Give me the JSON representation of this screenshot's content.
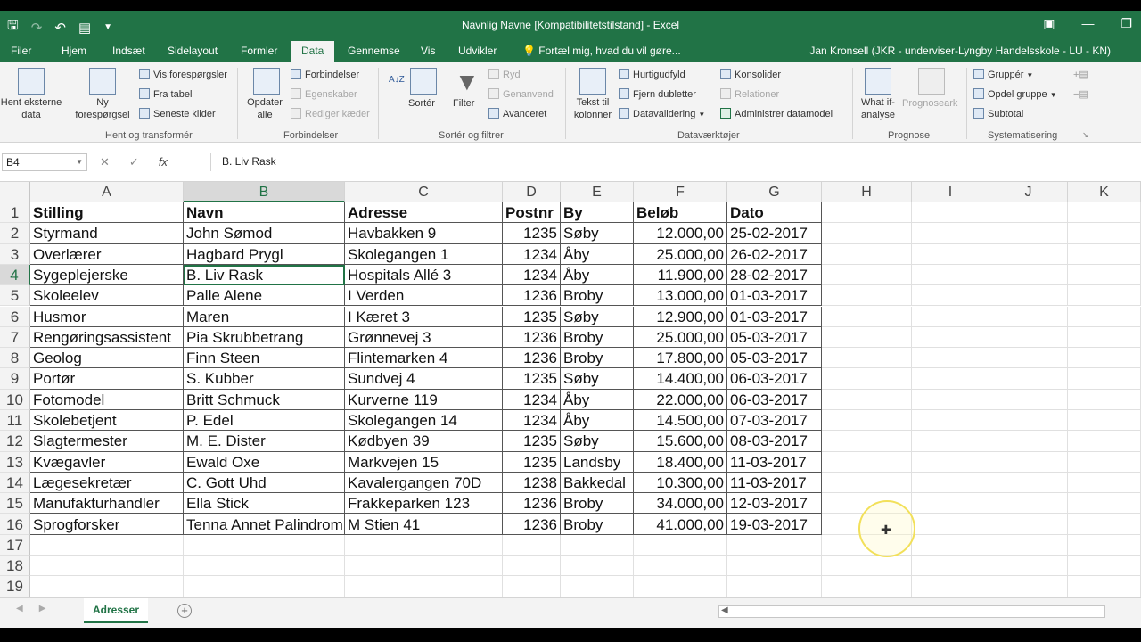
{
  "window": {
    "title": "Navnlig Navne  [Kompatibilitetstilstand] - Excel"
  },
  "ribbon_tabs": [
    {
      "label": "Filer"
    },
    {
      "label": "Hjem"
    },
    {
      "label": "Indsæt"
    },
    {
      "label": "Sidelayout"
    },
    {
      "label": "Formler"
    },
    {
      "label": "Data"
    },
    {
      "label": "Gennemse"
    },
    {
      "label": "Vis"
    },
    {
      "label": "Udvikler"
    }
  ],
  "tellme": "Fortæl mig, hvad du vil gøre...",
  "user": "Jan Kronsell (JKR - underviser-Lyngby Handelsskole - LU - KN)",
  "ribbon": {
    "hent_eksterne": [
      "Hent eksterne",
      "data"
    ],
    "ny": [
      "Ny",
      "forespørgsel"
    ],
    "vis_forespoergsler": "Vis forespørgsler",
    "fra_tabel": "Fra tabel",
    "seneste_kilder": "Seneste kilder",
    "group_hent": "Hent og transformér",
    "opdater": [
      "Opdater",
      "alle"
    ],
    "forbindelser": "Forbindelser",
    "egenskaber": "Egenskaber",
    "rediger_kaeder": "Rediger kæder",
    "group_forbindelser": "Forbindelser",
    "sorter": "Sortér",
    "filter": "Filter",
    "ryd": "Ryd",
    "genanvend": "Genanvend",
    "avanceret": "Avanceret",
    "group_sorter": "Sortér og filtrer",
    "tekst_til": [
      "Tekst til",
      "kolonner"
    ],
    "hurtigudfyld": "Hurtigudfyld",
    "fjern_dubletter": "Fjern dubletter",
    "datavalidering": "Datavalidering",
    "konsolider": "Konsolider",
    "relationer": "Relationer",
    "administrer": "Administrer datamodel",
    "group_datavaerktoejer": "Dataværktøjer",
    "what_if": [
      "What if-",
      "analyse"
    ],
    "prognoseark": "Prognoseark",
    "group_prognose": "Prognose",
    "grupper": "Gruppér",
    "opdel_gruppe": "Opdel gruppe",
    "subtotal": "Subtotal",
    "group_system": "Systematisering"
  },
  "formula_bar": {
    "name_box": "B4",
    "fx": "fx",
    "content": "B. Liv Rask"
  },
  "columns": [
    "A",
    "B",
    "C",
    "D",
    "E",
    "F",
    "G",
    "H",
    "I",
    "J",
    "K"
  ],
  "rows": [
    "1",
    "2",
    "3",
    "4",
    "5",
    "6",
    "7",
    "8",
    "9",
    "10",
    "11",
    "12",
    "13",
    "14",
    "15",
    "16",
    "17",
    "18",
    "19"
  ],
  "table": {
    "headers": [
      "Stilling",
      "Navn",
      "Adresse",
      "Postnr",
      "By",
      "Beløb",
      "Dato"
    ],
    "rows": [
      [
        "Styrmand",
        "John Sømod",
        "Havbakken 9",
        "1235",
        "Søby",
        "12.000,00",
        "25-02-2017"
      ],
      [
        "Overlærer",
        "Hagbard Prygl",
        "Skolegangen 1",
        "1234",
        "Åby",
        "25.000,00",
        "26-02-2017"
      ],
      [
        "Sygeplejerske",
        "B. Liv Rask",
        "Hospitals Allé 3",
        "1234",
        "Åby",
        "11.900,00",
        "28-02-2017"
      ],
      [
        "Skoleelev",
        "Palle Alene",
        "I Verden",
        "1236",
        "Broby",
        "13.000,00",
        "01-03-2017"
      ],
      [
        "Husmor",
        "Maren",
        "I Kæret 3",
        "1235",
        "Søby",
        "12.900,00",
        "01-03-2017"
      ],
      [
        "Rengøringsassistent",
        "Pia Skrubbetrang",
        "Grønnevej 3",
        "1236",
        "Broby",
        "25.000,00",
        "05-03-2017"
      ],
      [
        "Geolog",
        "Finn Steen",
        "Flintemarken 4",
        "1236",
        "Broby",
        "17.800,00",
        "05-03-2017"
      ],
      [
        "Portør",
        "S. Kubber",
        "Sundvej 4",
        "1235",
        "Søby",
        "14.400,00",
        "06-03-2017"
      ],
      [
        "Fotomodel",
        "Britt Schmuck",
        "Kurverne 119",
        "1234",
        "Åby",
        "22.000,00",
        "06-03-2017"
      ],
      [
        "Skolebetjent",
        "P. Edel",
        "Skolegangen 14",
        "1234",
        "Åby",
        "14.500,00",
        "07-03-2017"
      ],
      [
        "Slagtermester",
        "M. E. Dister",
        "Kødbyen 39",
        "1235",
        "Søby",
        "15.600,00",
        "08-03-2017"
      ],
      [
        "Kvægavler",
        "Ewald Oxe",
        "Markvejen 15",
        "1235",
        "Landsby",
        "18.400,00",
        "11-03-2017"
      ],
      [
        "Lægesekretær",
        "C. Gott Uhd",
        "Kavalergangen 70D",
        "1238",
        "Bakkedal",
        "10.300,00",
        "11-03-2017"
      ],
      [
        "Manufakturhandler",
        "Ella Stick",
        "Frakkeparken 123",
        "1236",
        "Broby",
        "34.000,00",
        "12-03-2017"
      ],
      [
        "Sprogforsker",
        "Tenna Annet Palindrom",
        "M Stien 41",
        "1236",
        "Broby",
        "41.000,00",
        "19-03-2017"
      ]
    ]
  },
  "sheet_tabs": [
    {
      "label": "Adresser"
    }
  ],
  "add_sheet": "+"
}
